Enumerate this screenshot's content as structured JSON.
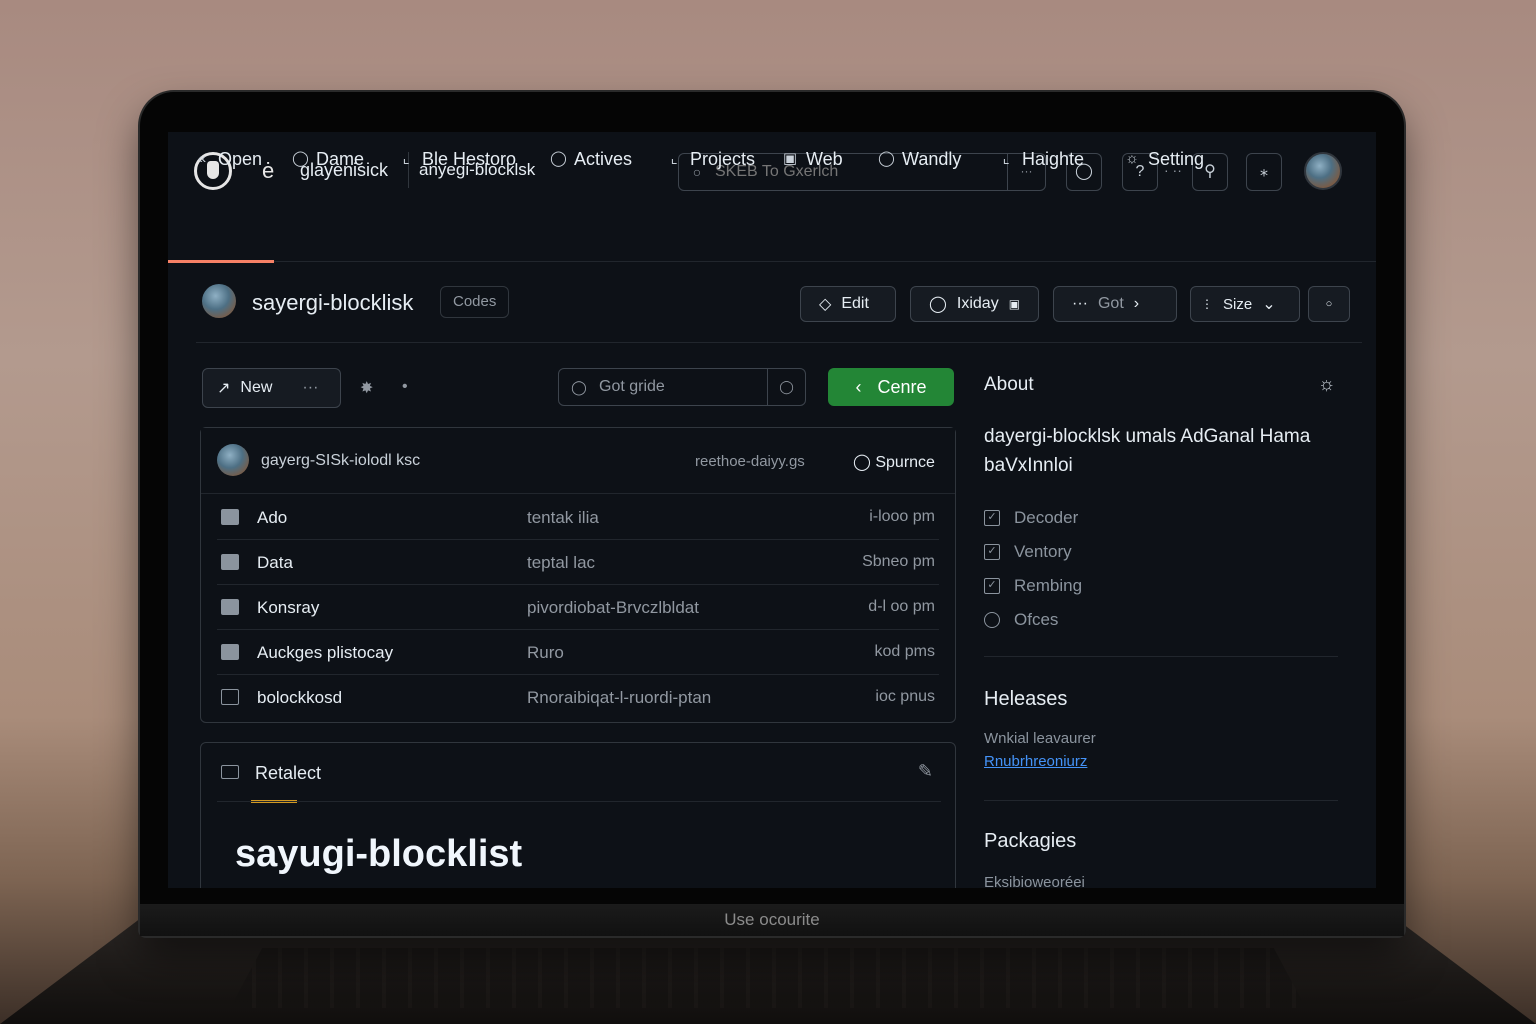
{
  "laptop": {
    "footer_text": "Use ocourite"
  },
  "header": {
    "owner": "glayenisick",
    "repo": "anyegi-blocklsk",
    "search_placeholder": "SKEB To Gxerlch",
    "search_kbd": "···"
  },
  "nav": {
    "tabs": [
      {
        "label": "Open",
        "icon": "code-chevrons-icon"
      },
      {
        "label": "Dame",
        "icon": "circle-dot-icon"
      },
      {
        "label": "Ble Hestoro",
        "icon": "pull-request-icon"
      },
      {
        "label": "Actives",
        "icon": "play-circle-icon"
      },
      {
        "label": "Projects",
        "icon": "table-icon"
      },
      {
        "label": "Web",
        "icon": "book-icon"
      },
      {
        "label": "Wandly",
        "icon": "shield-icon"
      },
      {
        "label": "Haighte",
        "icon": "graph-icon"
      },
      {
        "label": "Setting",
        "icon": "gear-icon"
      }
    ]
  },
  "repo": {
    "title": "sayergi-blocklisk",
    "badge": "Codes",
    "actions": {
      "edit": "Edit",
      "watch": "Ixiday",
      "more": "Got",
      "size": "Size"
    }
  },
  "toolbar": {
    "new": "New",
    "new_more": "···",
    "goto_placeholder": "Got gride",
    "code_button": "Cenre"
  },
  "commit": {
    "message": "gayerg-SISk-iolodl ksc",
    "hash": "reethoe-daiyy.gs",
    "stat": "Spurnce"
  },
  "files": [
    {
      "name": "Ado",
      "commit": "tentak ilia",
      "time": "i-looo pm",
      "type": "folder"
    },
    {
      "name": "Data",
      "commit": "teptal lac",
      "time": "Sbneo pm",
      "type": "folder"
    },
    {
      "name": "Konsray",
      "commit": "pivordiobat-Brvczlbldat",
      "time": "d-l oo pm",
      "type": "folder"
    },
    {
      "name": "Auckges plistocay",
      "commit": "Ruro",
      "time": "kod pms",
      "type": "folder"
    },
    {
      "name": "bolockkosd",
      "commit": "Rnoraibiqat-l-ruordi-ptan",
      "time": "ioc pnus",
      "type": "file"
    }
  ],
  "readme": {
    "tab": "Retalect",
    "heading": "sayugi-blocklist"
  },
  "sidebar": {
    "about_title": "About",
    "description": "dayergi-blocklsk umals AdGanal Hama baVxInnloi",
    "meta": [
      {
        "label": "Decoder",
        "icon": "check-square-icon"
      },
      {
        "label": "Ventory",
        "icon": "check-square-icon"
      },
      {
        "label": "Rembing",
        "icon": "check-square-icon"
      },
      {
        "label": "Ofces",
        "icon": "eye-icon"
      }
    ],
    "releases_title": "Heleases",
    "releases_sub": "Wnkial leavaurer",
    "releases_link": "Rnubrhreoniurz",
    "packages_title": "Packagies",
    "packages_sub": "Eksibioweoréei"
  },
  "colors": {
    "bg": "#0d1117",
    "accent_green": "#238636",
    "tab_underline": "#f78166",
    "readme_underline": "#d29922",
    "link": "#4493f8"
  }
}
